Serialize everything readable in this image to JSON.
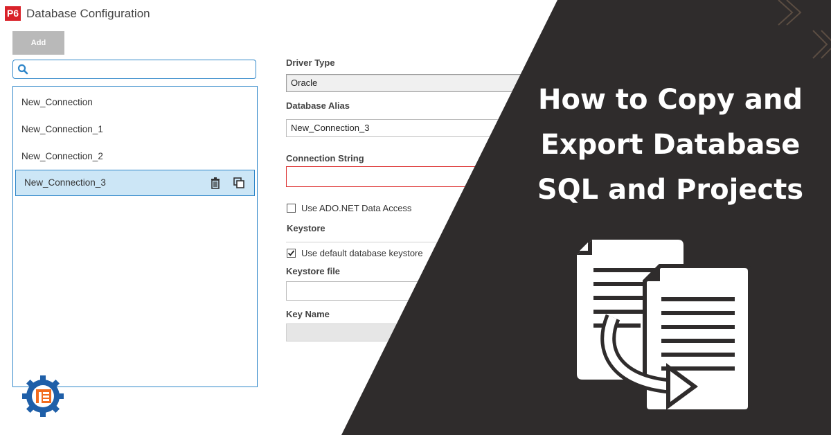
{
  "window": {
    "app_badge": "P6",
    "title": "Database Configuration"
  },
  "toolbar": {
    "add_label": "Add"
  },
  "search": {
    "value": "",
    "placeholder": ""
  },
  "connections": [
    {
      "name": "New_Connection",
      "selected": false
    },
    {
      "name": "New_Connection_1",
      "selected": false
    },
    {
      "name": "New_Connection_2",
      "selected": false
    },
    {
      "name": "New_Connection_3",
      "selected": true
    }
  ],
  "selected_row_icons": [
    "trash-icon",
    "copy-icon"
  ],
  "form": {
    "driver_type_label": "Driver Type",
    "driver_type_value": "Oracle",
    "database_alias_label": "Database Alias",
    "database_alias_value": "New_Connection_3",
    "connection_string_label": "Connection String",
    "connection_string_value": "",
    "ado_net_label": "Use ADO.NET Data Access",
    "ado_net_checked": false,
    "keystore_label": "Keystore",
    "default_keystore_label": "Use default database keystore",
    "default_keystore_checked": true,
    "keystore_file_label": "Keystore file",
    "keystore_file_value": "",
    "key_name_label": "Key Name",
    "key_name_value": ""
  },
  "banner": {
    "headline_lines": [
      "How to Copy and",
      "Export Database",
      "SQL and Projects"
    ],
    "illustration": "copy-documents-icon",
    "logo": "pe-gear-logo"
  },
  "colors": {
    "overlay": "#2f2c2c",
    "accent_blue": "#2e86c9",
    "selection": "#cce6f6",
    "error_border": "#dd3333",
    "app_badge": "#d9222a",
    "logo_blue": "#1f5fa8",
    "logo_orange": "#f26b1d"
  }
}
